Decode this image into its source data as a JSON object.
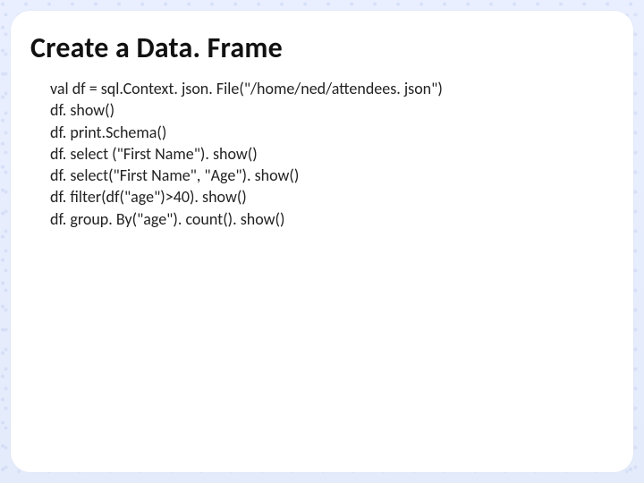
{
  "title": "Create a Data. Frame",
  "code_lines": [
    "val df = sql.Context. json. File(\"/home/ned/attendees. json\")",
    "df. show()",
    "df. print.Schema()",
    "df. select (\"First Name\"). show()",
    "df. select(\"First Name\", \"Age\"). show()",
    "df. filter(df(\"age\")>40). show()",
    "df. group. By(\"age\"). count(). show()"
  ]
}
